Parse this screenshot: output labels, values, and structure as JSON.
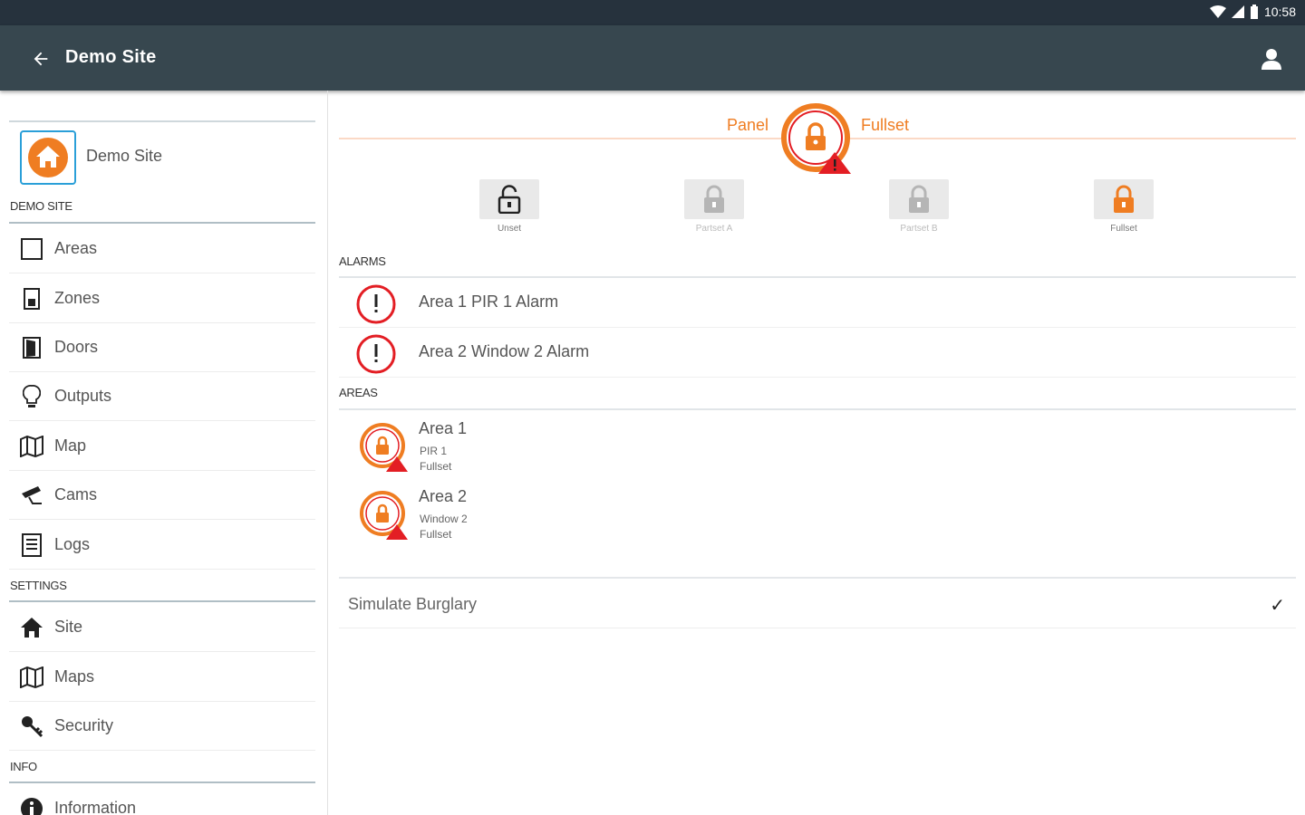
{
  "status_bar": {
    "time": "10:58",
    "wifi_icon": "wifi-icon",
    "signal_icon": "signal-icon",
    "battery_icon": "battery-icon"
  },
  "app_bar": {
    "title": "Demo Site",
    "back_icon": "arrow-back-icon",
    "account_icon": "account-icon"
  },
  "sidebar": {
    "site_name": "Demo Site",
    "sections": [
      {
        "header": "DEMO SITE",
        "items": [
          {
            "label": "Areas",
            "icon": "square-outline-icon"
          },
          {
            "label": "Zones",
            "icon": "sensor-icon"
          },
          {
            "label": "Doors",
            "icon": "door-icon"
          },
          {
            "label": "Outputs",
            "icon": "lightbulb-icon"
          },
          {
            "label": "Map",
            "icon": "map-icon"
          },
          {
            "label": "Cams",
            "icon": "cctv-icon"
          },
          {
            "label": "Logs",
            "icon": "list-icon"
          }
        ]
      },
      {
        "header": "SETTINGS",
        "items": [
          {
            "label": "Site",
            "icon": "home-icon"
          },
          {
            "label": "Maps",
            "icon": "map-icon"
          },
          {
            "label": "Security",
            "icon": "key-icon"
          }
        ]
      },
      {
        "header": "INFO",
        "items": [
          {
            "label": "Information",
            "icon": "info-icon"
          }
        ]
      }
    ]
  },
  "panel": {
    "label": "Panel",
    "state": "Fullset",
    "modes": [
      {
        "label": "Unset",
        "enabled": true
      },
      {
        "label": "Partset A",
        "enabled": false
      },
      {
        "label": "Partset B",
        "enabled": false
      },
      {
        "label": "Fullset",
        "enabled": true
      }
    ]
  },
  "alarms": {
    "header": "ALARMS",
    "items": [
      {
        "label": "Area 1 PIR 1 Alarm"
      },
      {
        "label": "Area 2 Window 2 Alarm"
      }
    ]
  },
  "areas": {
    "header": "AREAS",
    "items": [
      {
        "name": "Area 1",
        "zone": "PIR 1",
        "state": "Fullset"
      },
      {
        "name": "Area 2",
        "zone": "Window 2",
        "state": "Fullset"
      }
    ]
  },
  "simulate": {
    "label": "Simulate Burglary",
    "checked": true,
    "check_glyph": "✓"
  },
  "colors": {
    "app_bar": "#37474f",
    "status_bar": "#26323d",
    "accent_orange": "#ef7d22",
    "alarm_red": "#e31e24",
    "site_blue": "#2a9fd8"
  }
}
